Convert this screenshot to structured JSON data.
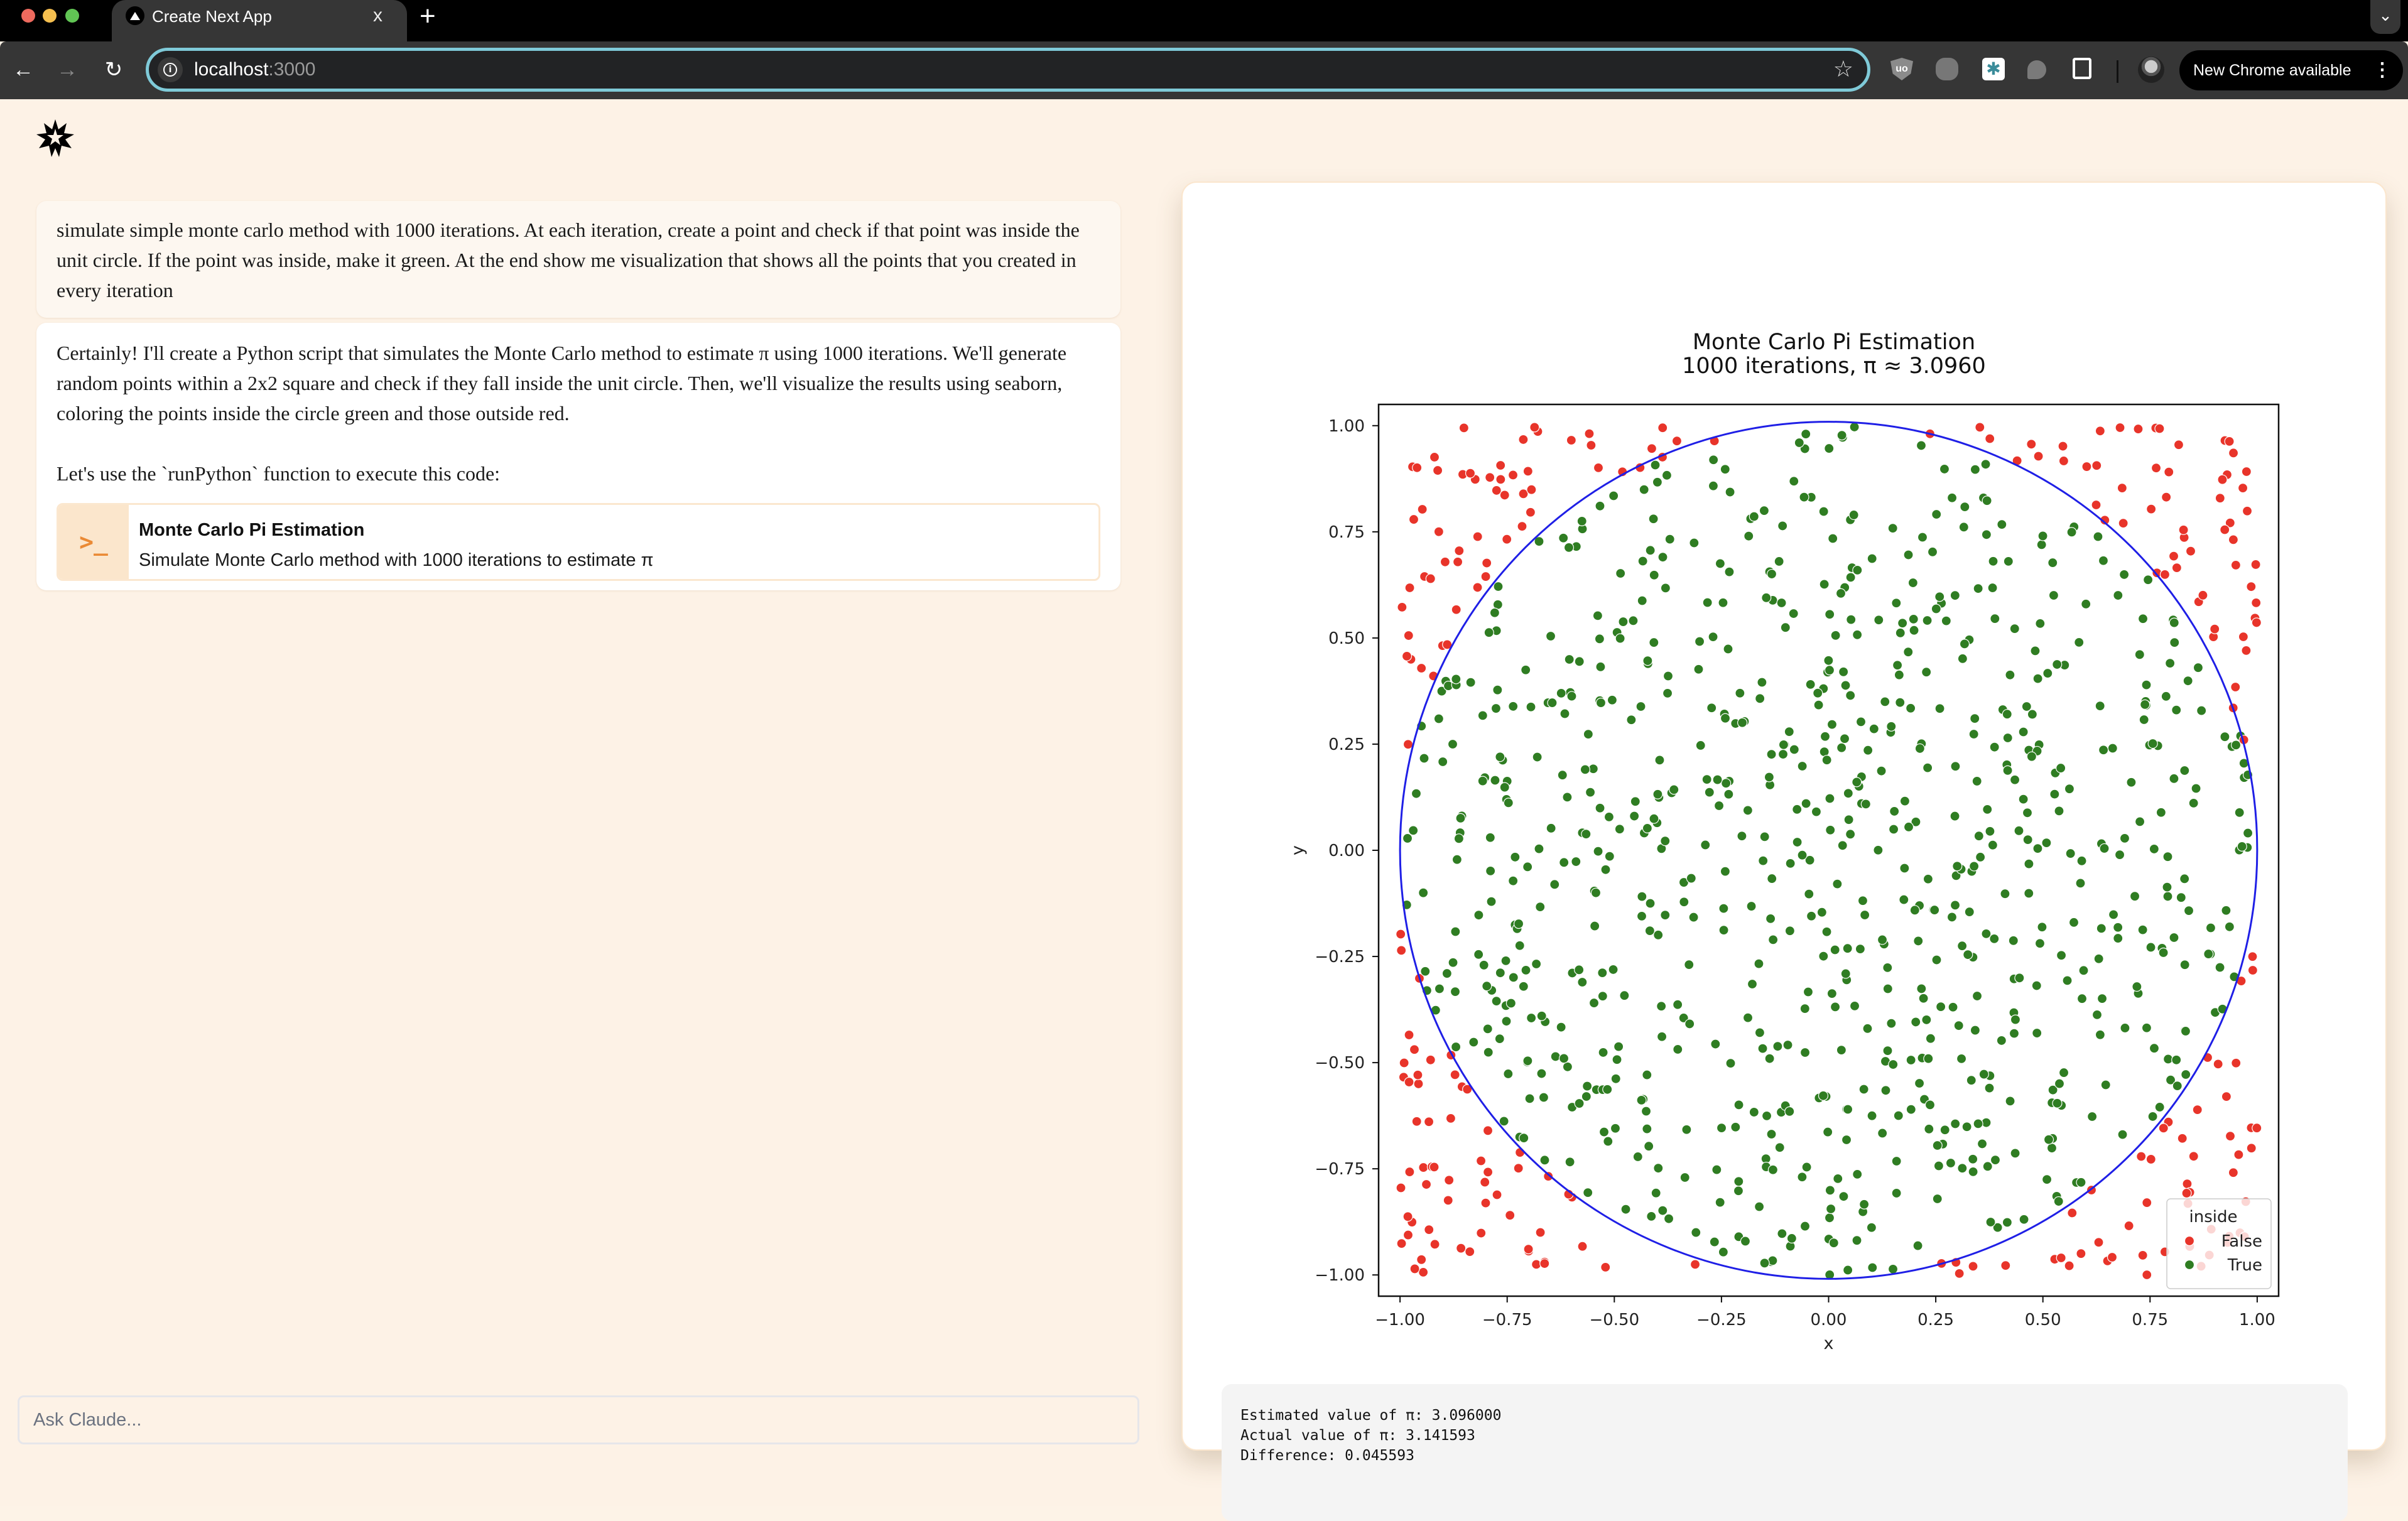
{
  "browser": {
    "tab_title": "Create Next App",
    "tab_close": "x",
    "new_tab": "+",
    "url_host": "localhost",
    "url_port": ":3000",
    "update_button": "New Chrome available",
    "icons": [
      "back-icon",
      "forward-icon",
      "reload-icon",
      "site-info-icon",
      "bookmark-star-icon",
      "ublock-extension-icon",
      "raccoon-extension-icon",
      "perplexity-extension-icon",
      "bird-extension-icon",
      "extensions-puzzle-icon",
      "profile-avatar",
      "more-menu-icon",
      "tab-search-icon"
    ]
  },
  "chat": {
    "user_message": "simulate simple monte carlo method with 1000 iterations. At each iteration, create a point and check if that point was inside the unit circle. If the point was inside, make it green. At the end show me visualization that shows all the points that you created in every iteration",
    "assistant_paragraphs": [
      "Certainly! I'll create a Python script that simulates the Monte Carlo method to estimate π using 1000 iterations. We'll generate random points within a 2x2 square and check if they fall inside the unit circle. Then, we'll visualize the results using seaborn, coloring the points inside the circle green and those outside red.",
      "Let's use the `runPython` function to execute this code:"
    ],
    "tool_call": {
      "icon": ">_",
      "title": "Monte Carlo Pi Estimation",
      "description": "Simulate Monte Carlo method with 1000 iterations to estimate π"
    },
    "input_placeholder": "Ask Claude..."
  },
  "output": {
    "lines": [
      "Estimated value of π: 3.096000",
      "Actual value of π: 3.141593",
      "Difference: 0.045593"
    ]
  },
  "chart_data": {
    "type": "scatter",
    "title": "Monte Carlo Pi Estimation",
    "subtitle": "1000 iterations, π ≈ 3.0960",
    "xlabel": "x",
    "ylabel": "y",
    "xlim": [
      -1.05,
      1.05
    ],
    "ylim": [
      -1.05,
      1.05
    ],
    "xticks": [
      "−1.00",
      "−0.75",
      "−0.50",
      "−0.25",
      "0.00",
      "0.25",
      "0.50",
      "0.75",
      "1.00"
    ],
    "yticks": [
      "1.00",
      "0.75",
      "0.50",
      "0.25",
      "0.00",
      "−0.25",
      "−0.50",
      "−0.75",
      "−1.00"
    ],
    "tick_values": [
      -1,
      -0.75,
      -0.5,
      -0.25,
      0,
      0.25,
      0.5,
      0.75,
      1
    ],
    "grid": false,
    "total_points": 1000,
    "points_inside": 774,
    "points_outside": 226,
    "point_distribution": "uniform random in [-1, 1] × [-1, 1]",
    "overlay": {
      "shape": "unit-circle",
      "center": [
        0,
        0
      ],
      "radius": 1,
      "color": "#1f1fe6"
    },
    "legend": {
      "title": "inside",
      "placement": "lower-right",
      "entries": [
        {
          "label": "False",
          "color": "#e8342a"
        },
        {
          "label": "True",
          "color": "#2f7d22"
        }
      ]
    }
  }
}
